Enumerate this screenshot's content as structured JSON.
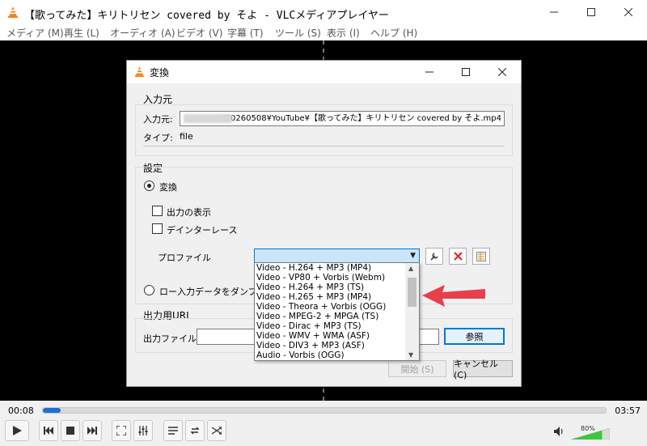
{
  "window": {
    "title": "【歌ってみた】キリトリセン covered by そよ - VLCメディアプレイヤー",
    "menu": [
      "メディア (M)",
      "再生 (L)",
      "オーディオ (A)",
      "ビデオ (V)",
      "字幕 (T)",
      "ツール (S)",
      "表示 (I)",
      "ヘルプ (H)"
    ]
  },
  "player": {
    "time_current": "00:08",
    "time_total": "03:57",
    "progress_fraction": 0.032,
    "volume_label": "80%",
    "volume_fraction": 0.8
  },
  "dialog": {
    "title": "変換",
    "source_group": "入力元",
    "source_label": "入力元:",
    "source_value": "¥20260508¥YouTube¥【歌ってみた】キリトリセン covered by そよ.mp4",
    "type_label": "タイプ:",
    "type_value": "file",
    "settings_group": "設定",
    "convert_radio": "変換",
    "show_output_check": "出力の表示",
    "deinterlace_check": "デインターレース",
    "profile_label": "プロファイル",
    "raw_dump_radio": "ロー入力データをダンプ",
    "dest_group": "出力用URL",
    "dest_label": "出力ファイル:",
    "browse_button": "参照",
    "start_button": "開始 (S)",
    "cancel_button": "キャンセル (C)"
  },
  "profile_options": [
    "Video - H.264 + MP3 (MP4)",
    "Video - VP80 + Vorbis (Webm)",
    "Video - H.264 + MP3 (TS)",
    "Video - H.265 + MP3 (MP4)",
    "Video - Theora + Vorbis (OGG)",
    "Video - MPEG-2 + MPGA (TS)",
    "Video - Dirac + MP3 (TS)",
    "Video - WMV + WMA (ASF)",
    "Video - DIV3 + MP3 (ASF)",
    "Audio - Vorbis (OGG)"
  ],
  "colors": {
    "accent": "#0078d7",
    "seek": "#1e6fd0",
    "arrow": "#e8404a",
    "volume": "#3cc73c"
  }
}
